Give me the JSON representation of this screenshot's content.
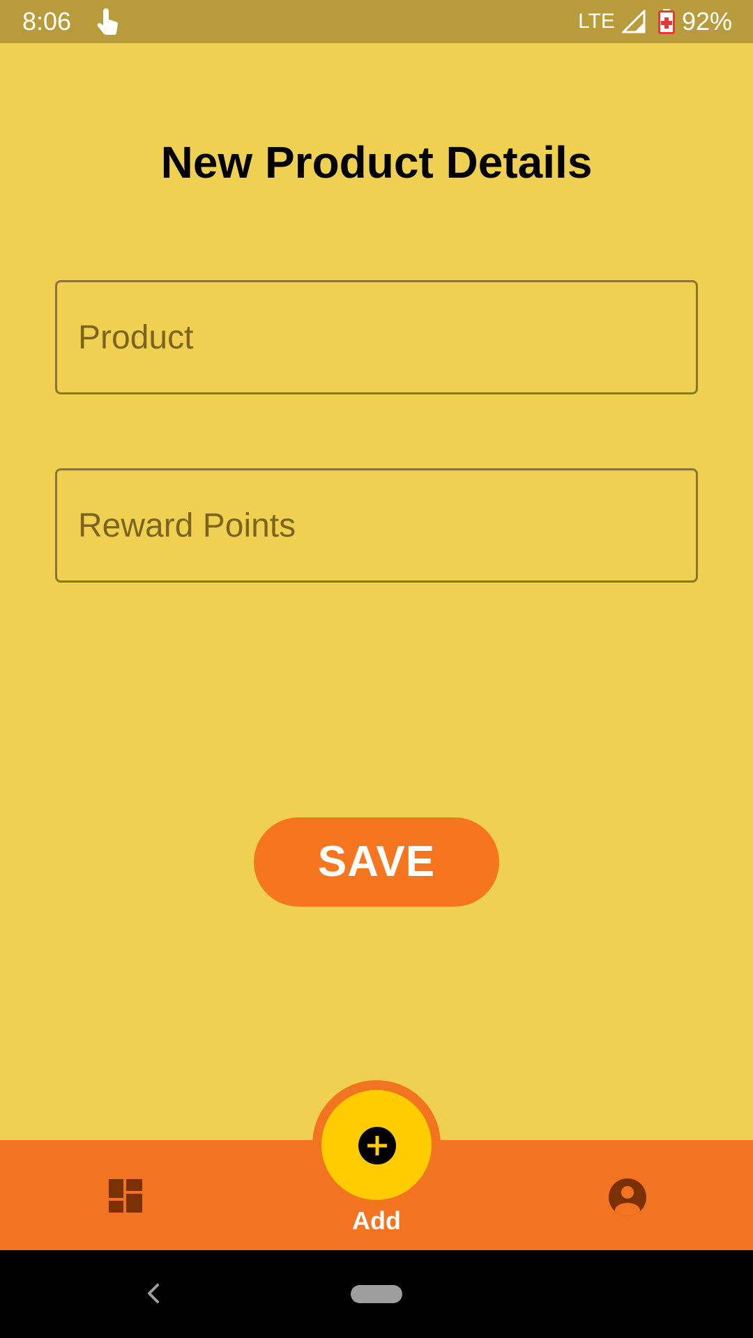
{
  "status_bar": {
    "time": "8:06",
    "network": "LTE",
    "battery": "92%"
  },
  "page": {
    "title": "New Product Details"
  },
  "form": {
    "product_placeholder": "Product",
    "reward_points_placeholder": "Reward Points",
    "save_label": "SAVE"
  },
  "bottom_nav": {
    "add_label": "Add",
    "icons": [
      "dashboard-icon",
      "add-circle-icon",
      "profile-icon"
    ]
  },
  "colors": {
    "background": "#f0d050",
    "status_bar": "#b89c3c",
    "accent_orange": "#f37420",
    "fab_yellow": "#ffcc00",
    "icon_dark": "#7a3000"
  }
}
